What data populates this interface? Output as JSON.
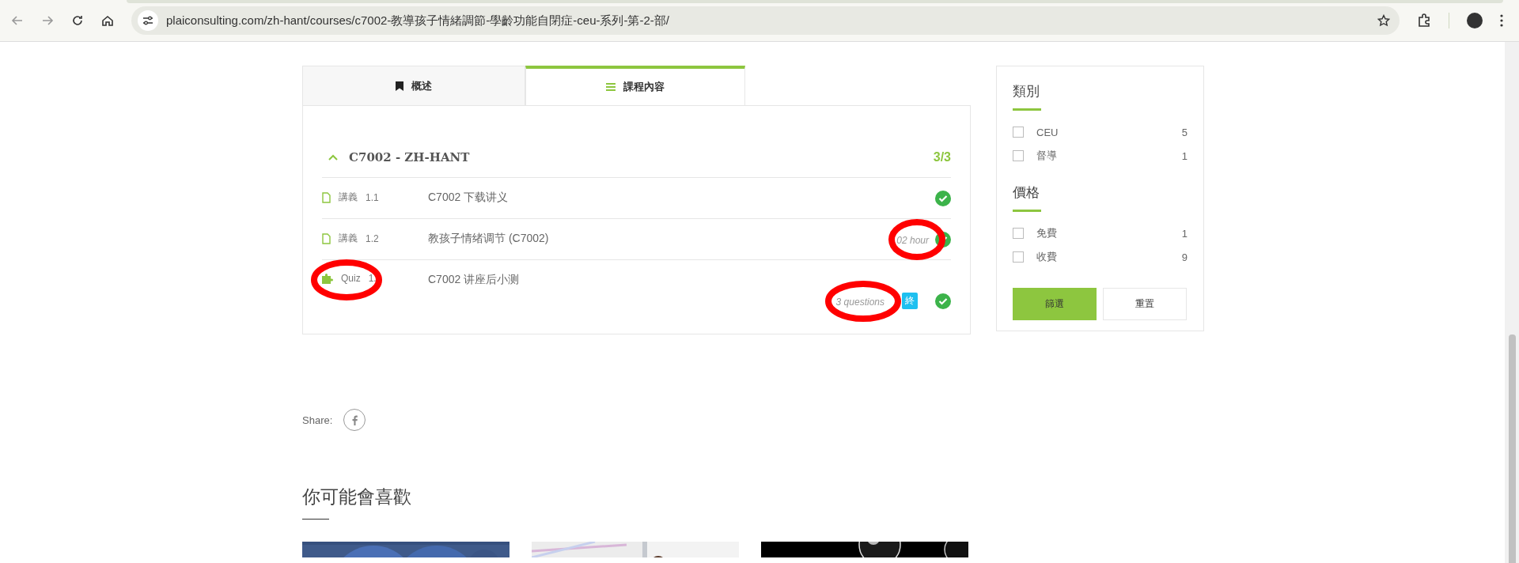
{
  "browser": {
    "url": "plaiconsulting.com/zh-hant/courses/c7002-教導孩子情緒調節-學齡功能自閉症-ceu-系列-第-2-部/"
  },
  "tabs": [
    {
      "label": "概述",
      "selected": false
    },
    {
      "label": "課程內容",
      "selected": true
    }
  ],
  "section": {
    "title": "C7002 - ZH-HANT",
    "count": "3/3",
    "expanded": true,
    "items": [
      {
        "kind": "lesson",
        "type_label": "講義",
        "number": "1.1",
        "title": "C7002 下载讲义",
        "completed": true,
        "label_circled": false
      },
      {
        "kind": "lesson",
        "type_label": "講義",
        "number": "1.2",
        "title": "教孩子情绪调节 (C7002)",
        "meta": "02 hour",
        "completed": true,
        "label_circled": false,
        "meta_circled": true
      },
      {
        "kind": "quiz",
        "type_label": "Quiz",
        "number": "1.",
        "title": "C7002 讲座后小测",
        "meta": "3 questions",
        "badge": "終",
        "completed": true,
        "label_circled": true,
        "meta_circled": true
      }
    ]
  },
  "share": {
    "label": "Share:"
  },
  "related": {
    "title": "你可能會喜歡"
  },
  "filters": [
    {
      "title": "類別",
      "options": [
        {
          "label": "CEU",
          "count": "5",
          "checked": false
        },
        {
          "label": "督導",
          "count": "1",
          "checked": false
        }
      ]
    },
    {
      "title": "價格",
      "options": [
        {
          "label": "免費",
          "count": "1",
          "checked": false
        },
        {
          "label": "收費",
          "count": "9",
          "checked": false
        }
      ]
    }
  ],
  "filter_buttons": [
    {
      "label": "篩選",
      "kind": "primary"
    },
    {
      "label": "重置",
      "kind": "secondary"
    }
  ]
}
